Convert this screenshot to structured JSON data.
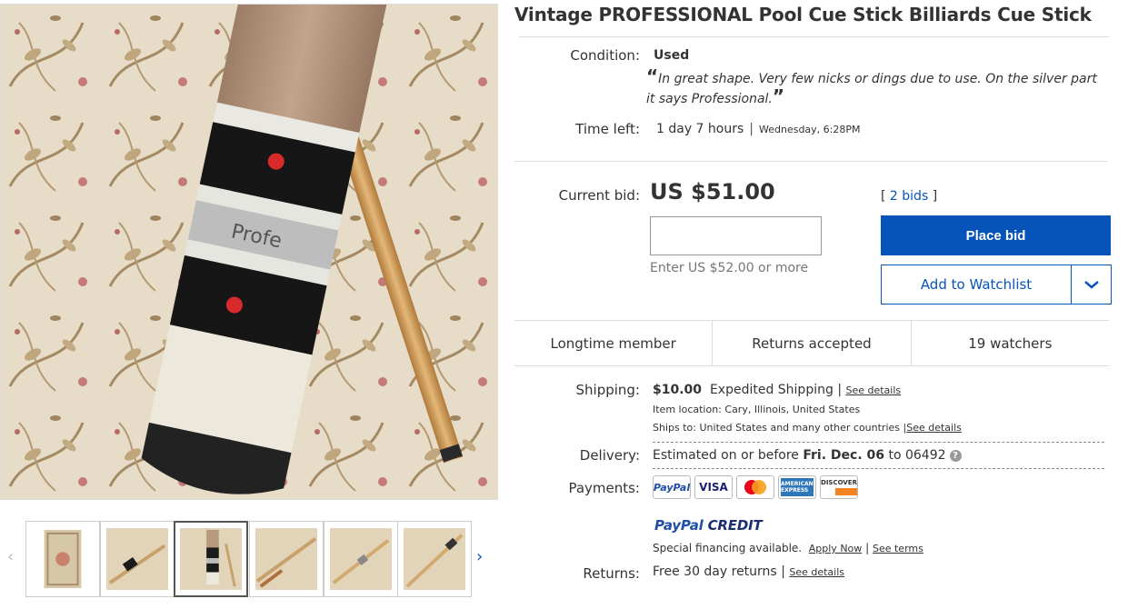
{
  "title": "Vintage PROFESSIONAL Pool Cue Stick Billiards Cue Stick",
  "condition": {
    "label": "Condition:",
    "value": "Used",
    "quote_open": "“",
    "quote_text": "In great shape. Very few nicks or dings due to use. On the silver part it says Professional.",
    "quote_close": "”"
  },
  "time_left": {
    "label": "Time left:",
    "value": "1 day 7 hours",
    "separator": "|",
    "end_time": "Wednesday, 6:28PM"
  },
  "bid": {
    "label": "Current bid:",
    "price": "US $51.00",
    "input_value": "",
    "hint": "Enter US $52.00 or more",
    "bids_open": "[ ",
    "bids_count": "2 bids",
    "bids_close": " ]",
    "place_bid": "Place bid",
    "watchlist": "Add to Watchlist"
  },
  "badges": [
    "Longtime member",
    "Returns accepted",
    "19 watchers"
  ],
  "shipping": {
    "label": "Shipping:",
    "price": "$10.00",
    "method": "Expedited Shipping",
    "sep": "|",
    "details": "See details",
    "location_label": "Item location:",
    "location": "Cary, Illinois, United States",
    "ships_to_label": "Ships to:",
    "ships_to": "United States and many other countries",
    "ships_to_details": "See details"
  },
  "delivery": {
    "label": "Delivery:",
    "prefix": "Estimated on or before",
    "date": "Fri. Dec. 06",
    "to": "to",
    "zip": "06492",
    "help": "?"
  },
  "payments": {
    "label": "Payments:",
    "cards": [
      "PayPal",
      "VISA",
      "MasterCard",
      "AMERICAN EXPRESS",
      "DISCOVER"
    ],
    "ppcredit_a": "PayPal",
    "ppcredit_b": "CREDIT",
    "financing": "Special financing available.",
    "apply": "Apply Now",
    "sep": "|",
    "terms": "See terms"
  },
  "returns": {
    "label": "Returns:",
    "value": "Free 30 day returns",
    "sep": "|",
    "details": "See details"
  },
  "gallery": {
    "prev": "‹",
    "next": "›",
    "thumbnails": [
      "rug",
      "cue-rug",
      "cue-closeup",
      "cue-rug",
      "cue-rug",
      "cue-rug"
    ]
  },
  "colors": {
    "accent": "#0654ba",
    "carpet": "#e5d9c4",
    "cue_wood": "#d9a868",
    "ferrule": "#ece8dc"
  }
}
